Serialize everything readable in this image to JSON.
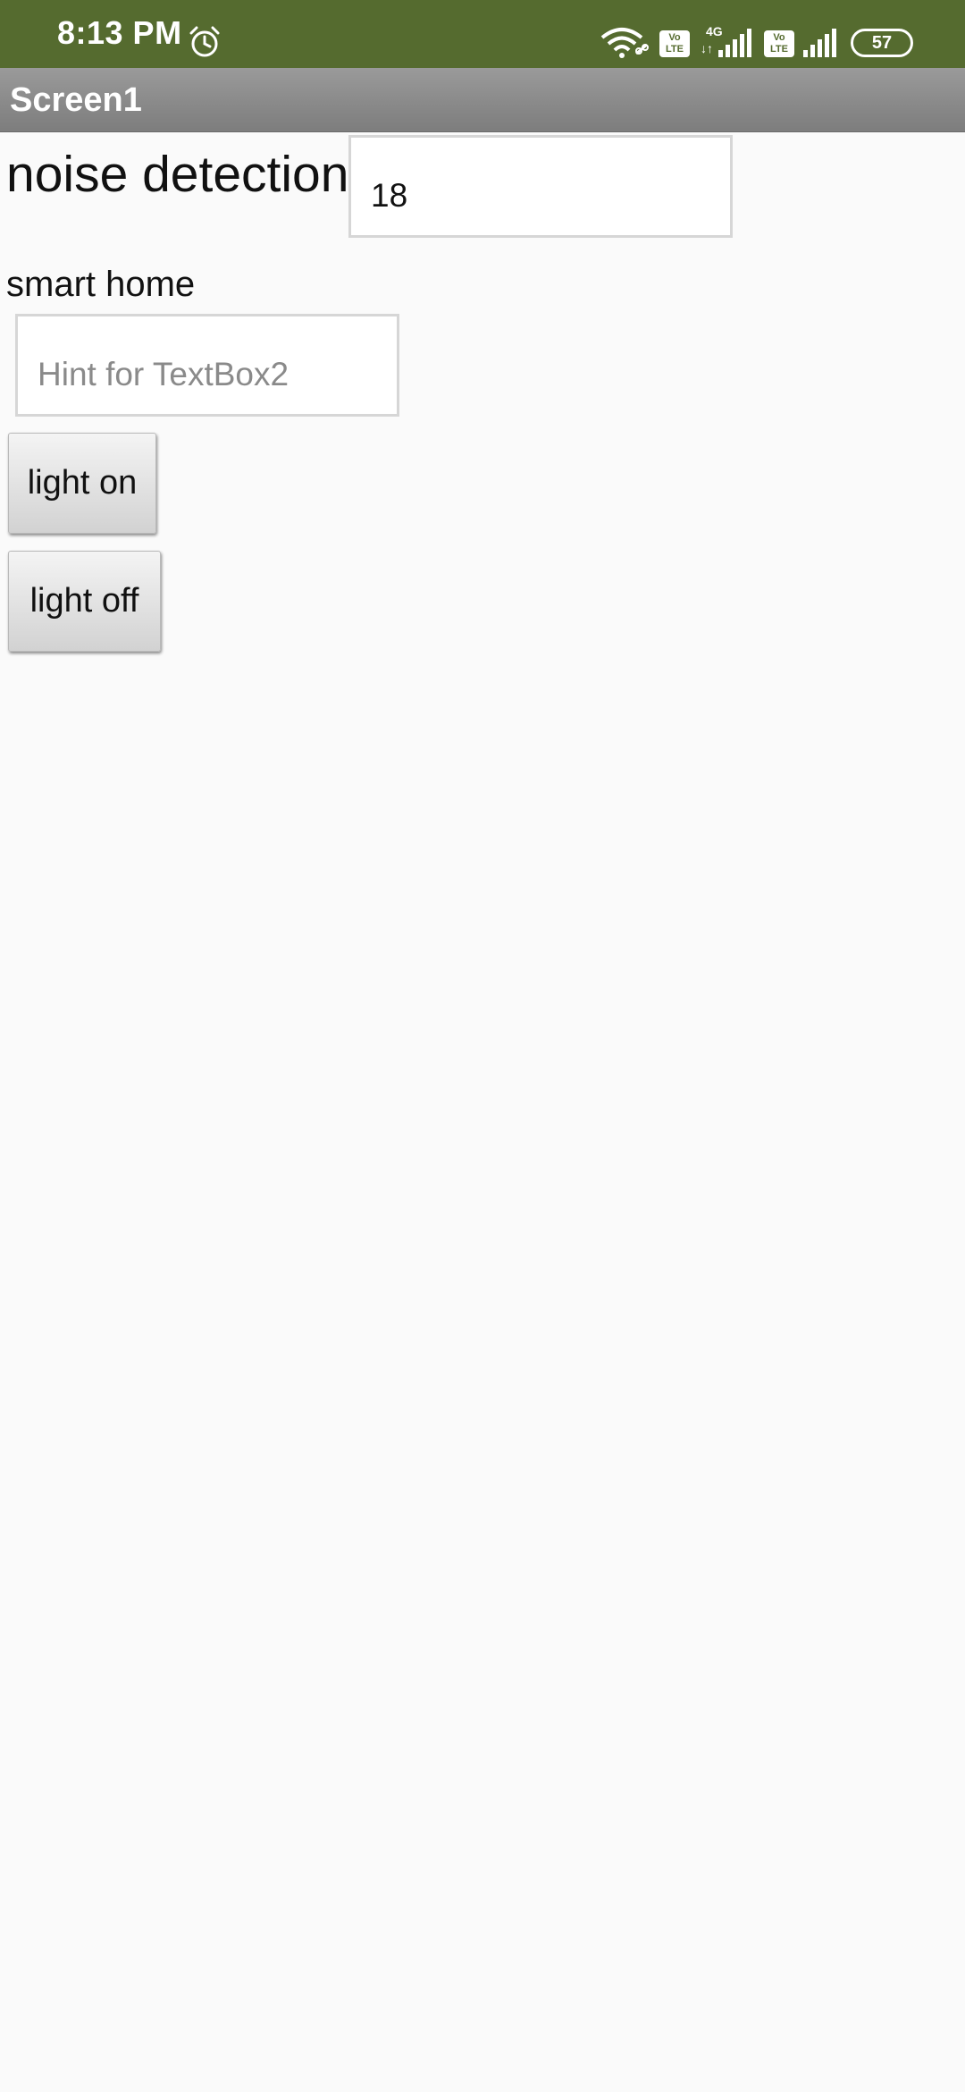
{
  "status_bar": {
    "time": "8:13 PM",
    "alarm_icon": "alarm-clock-icon",
    "wifi_icon": "wifi-icon",
    "volte_label": "Vo LTE",
    "network_type": "4G",
    "data_arrows": "↓↑",
    "signal_icon": "cell-signal-icon",
    "battery": "57",
    "background_color": "#556b2f"
  },
  "title_bar": {
    "title": "Screen1",
    "background_color": "#8a8a8a"
  },
  "main": {
    "noise_label": "noise detection",
    "noise_value": "18",
    "smart_home_label": "smart home",
    "textbox2_value": "",
    "textbox2_placeholder": "Hint for TextBox2",
    "light_on_label": "light on",
    "light_off_label": "light off"
  }
}
